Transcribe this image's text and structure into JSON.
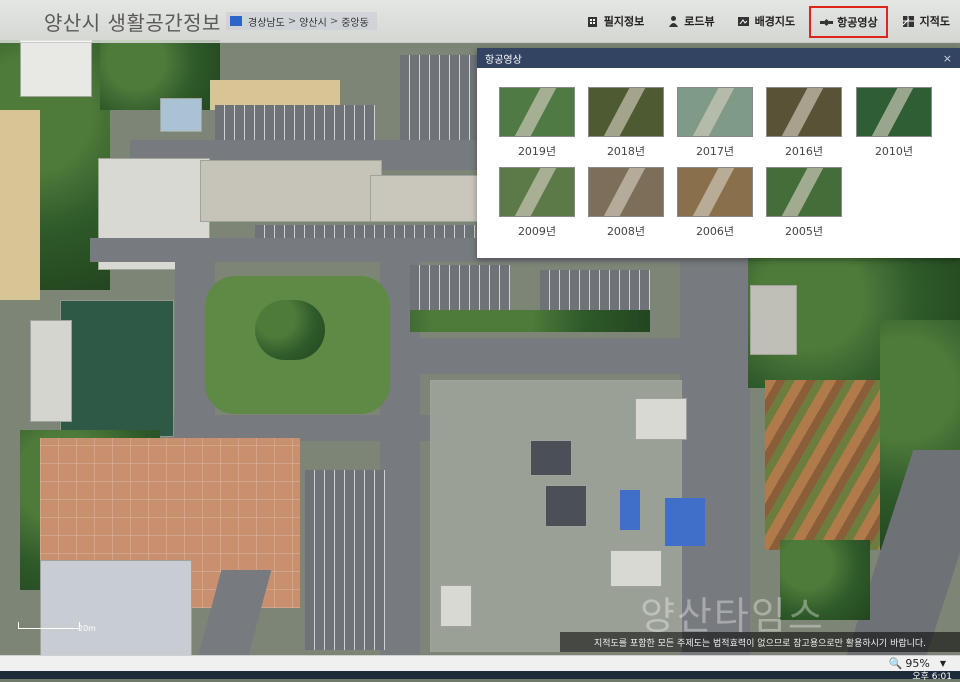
{
  "app": {
    "title": "양산시 생활공간정보",
    "breadcrumb": [
      "경상남도",
      "양산시",
      "중앙동"
    ]
  },
  "toolbar": {
    "items": [
      {
        "label": "필지정보",
        "icon": "building-icon"
      },
      {
        "label": "로드뷰",
        "icon": "person-icon"
      },
      {
        "label": "배경지도",
        "icon": "map-icon"
      },
      {
        "label": "항공영상",
        "icon": "satellite-icon",
        "active": true
      },
      {
        "label": "지적도",
        "icon": "parcel-map-icon"
      }
    ],
    "highlight_color": "#e0241a"
  },
  "aerial_panel": {
    "title": "항공영상",
    "close": "×",
    "years": [
      {
        "label": "2019년",
        "tone": "#4f7a44"
      },
      {
        "label": "2018년",
        "tone": "#4d5a32"
      },
      {
        "label": "2017년",
        "tone": "#7f9a86"
      },
      {
        "label": "2016년",
        "tone": "#5a5236"
      },
      {
        "label": "2010년",
        "tone": "#2f5e35"
      },
      {
        "label": "2009년",
        "tone": "#5b7a48"
      },
      {
        "label": "2008년",
        "tone": "#7d6e5a"
      },
      {
        "label": "2006년",
        "tone": "#8a6f4b"
      },
      {
        "label": "2005년",
        "tone": "#446d3a"
      }
    ],
    "header_color": "#334463"
  },
  "map": {
    "notice": "지적도를 포함한 모든 주제도는 법적효력이 없으므로 참고용으로만 활용하시기 바랍니다.",
    "scale_label": "20m",
    "watermark": "양산타임스"
  },
  "statusbar": {
    "zoom": "95%",
    "clock": "오후 6:01"
  }
}
